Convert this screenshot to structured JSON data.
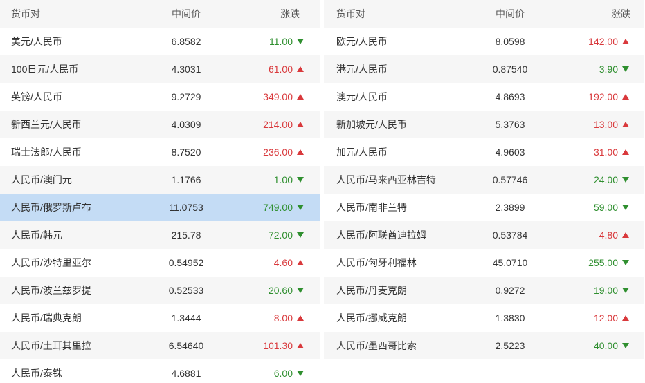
{
  "headers": {
    "pair": "货币对",
    "mid": "中间价",
    "change": "涨跌"
  },
  "colors": {
    "up": "#d9393c",
    "down": "#2f8f2f",
    "selected": "#c4dcf5",
    "stripe": "#f6f6f6"
  },
  "left": [
    {
      "pair": "美元/人民币",
      "mid": "6.8582",
      "change": "11.00",
      "dir": "down"
    },
    {
      "pair": "100日元/人民币",
      "mid": "4.3031",
      "change": "61.00",
      "dir": "up"
    },
    {
      "pair": "英镑/人民币",
      "mid": "9.2729",
      "change": "349.00",
      "dir": "up"
    },
    {
      "pair": "新西兰元/人民币",
      "mid": "4.0309",
      "change": "214.00",
      "dir": "up"
    },
    {
      "pair": "瑞士法郎/人民币",
      "mid": "8.7520",
      "change": "236.00",
      "dir": "up"
    },
    {
      "pair": "人民币/澳门元",
      "mid": "1.1766",
      "change": "1.00",
      "dir": "down"
    },
    {
      "pair": "人民币/俄罗斯卢布",
      "mid": "11.0753",
      "change": "749.00",
      "dir": "down",
      "selected": true
    },
    {
      "pair": "人民币/韩元",
      "mid": "215.78",
      "change": "72.00",
      "dir": "down"
    },
    {
      "pair": "人民币/沙特里亚尔",
      "mid": "0.54952",
      "change": "4.60",
      "dir": "up"
    },
    {
      "pair": "人民币/波兰兹罗提",
      "mid": "0.52533",
      "change": "20.60",
      "dir": "down"
    },
    {
      "pair": "人民币/瑞典克朗",
      "mid": "1.3444",
      "change": "8.00",
      "dir": "up"
    },
    {
      "pair": "人民币/土耳其里拉",
      "mid": "6.54640",
      "change": "101.30",
      "dir": "up"
    },
    {
      "pair": "人民币/泰铢",
      "mid": "4.6881",
      "change": "6.00",
      "dir": "down"
    }
  ],
  "right": [
    {
      "pair": "欧元/人民币",
      "mid": "8.0598",
      "change": "142.00",
      "dir": "up"
    },
    {
      "pair": "港元/人民币",
      "mid": "0.87540",
      "change": "3.90",
      "dir": "down"
    },
    {
      "pair": "澳元/人民币",
      "mid": "4.8693",
      "change": "192.00",
      "dir": "up"
    },
    {
      "pair": "新加坡元/人民币",
      "mid": "5.3763",
      "change": "13.00",
      "dir": "up"
    },
    {
      "pair": "加元/人民币",
      "mid": "4.9603",
      "change": "31.00",
      "dir": "up"
    },
    {
      "pair": "人民币/马来西亚林吉特",
      "mid": "0.57746",
      "change": "24.00",
      "dir": "down"
    },
    {
      "pair": "人民币/南非兰特",
      "mid": "2.3899",
      "change": "59.00",
      "dir": "down"
    },
    {
      "pair": "人民币/阿联酋迪拉姆",
      "mid": "0.53784",
      "change": "4.80",
      "dir": "up"
    },
    {
      "pair": "人民币/匈牙利福林",
      "mid": "45.0710",
      "change": "255.00",
      "dir": "down"
    },
    {
      "pair": "人民币/丹麦克朗",
      "mid": "0.9272",
      "change": "19.00",
      "dir": "down"
    },
    {
      "pair": "人民币/挪威克朗",
      "mid": "1.3830",
      "change": "12.00",
      "dir": "up"
    },
    {
      "pair": "人民币/墨西哥比索",
      "mid": "2.5223",
      "change": "40.00",
      "dir": "down"
    }
  ]
}
